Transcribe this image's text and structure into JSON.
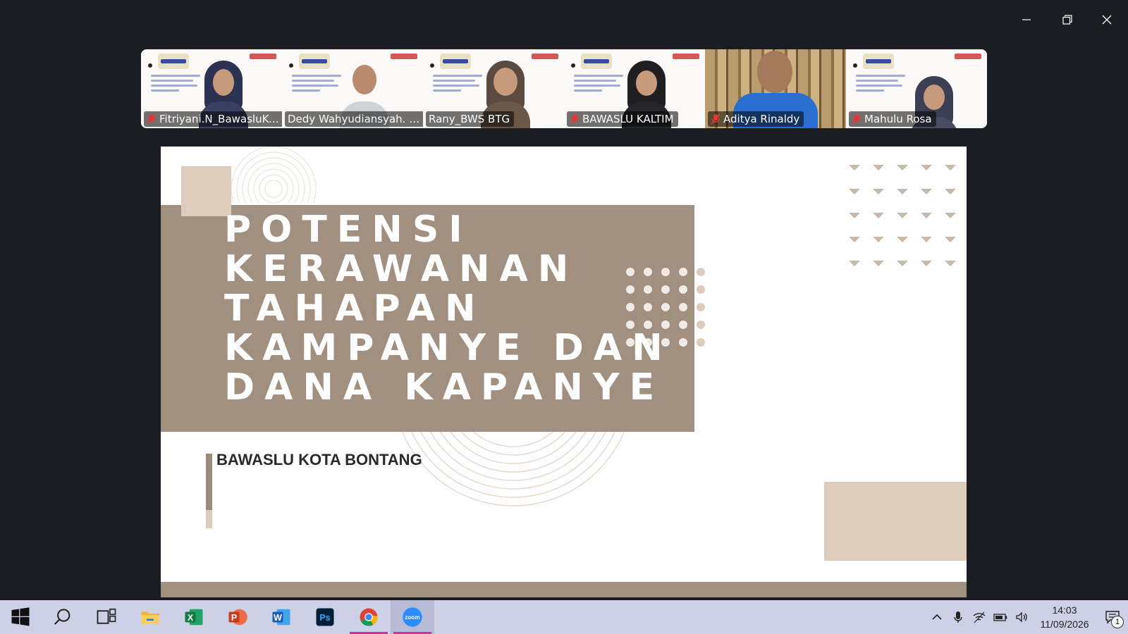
{
  "window": {
    "controls": [
      "minimize-icon",
      "restore-icon",
      "close-icon"
    ]
  },
  "participants": [
    {
      "name": "Fitriyani.N_BawasluKu...",
      "muted": true,
      "active": false
    },
    {
      "name": "Dedy Wahyudiansyah. SE....",
      "muted": false,
      "active": false
    },
    {
      "name": "Rany_BWS BTG",
      "muted": false,
      "active": true
    },
    {
      "name": "BAWASLU KALTIM",
      "muted": true,
      "active": false
    },
    {
      "name": "Aditya Rinaldy",
      "muted": true,
      "active": false
    },
    {
      "name": "Mahulu Rosa",
      "muted": true,
      "active": false
    }
  ],
  "slide": {
    "title_lines": "POTENSI\nKERAWANAN\nTAHAPAN\nKAMPANYE DAN\nDANA KAPANYE",
    "subtitle": "BAWASLU KOTA BONTANG",
    "colors": {
      "band": "#a19080",
      "accent_light": "#ddcbbb"
    }
  },
  "taskbar": {
    "apps": [
      {
        "name": "start-icon"
      },
      {
        "name": "search-icon"
      },
      {
        "name": "task-view-icon"
      },
      {
        "name": "file-explorer-icon"
      },
      {
        "name": "excel-icon"
      },
      {
        "name": "powerpoint-icon"
      },
      {
        "name": "word-icon"
      },
      {
        "name": "photoshop-icon"
      },
      {
        "name": "chrome-icon",
        "running": true
      },
      {
        "name": "zoom-icon",
        "running": true,
        "active": true
      }
    ],
    "zoom_label": "zoom",
    "photoshop_label": "Ps",
    "excel_label": "X",
    "powerpoint_label": "P",
    "word_label": "W",
    "clock": {
      "time": "14:03",
      "date": "11/09/2026"
    },
    "notification_count": "1"
  }
}
